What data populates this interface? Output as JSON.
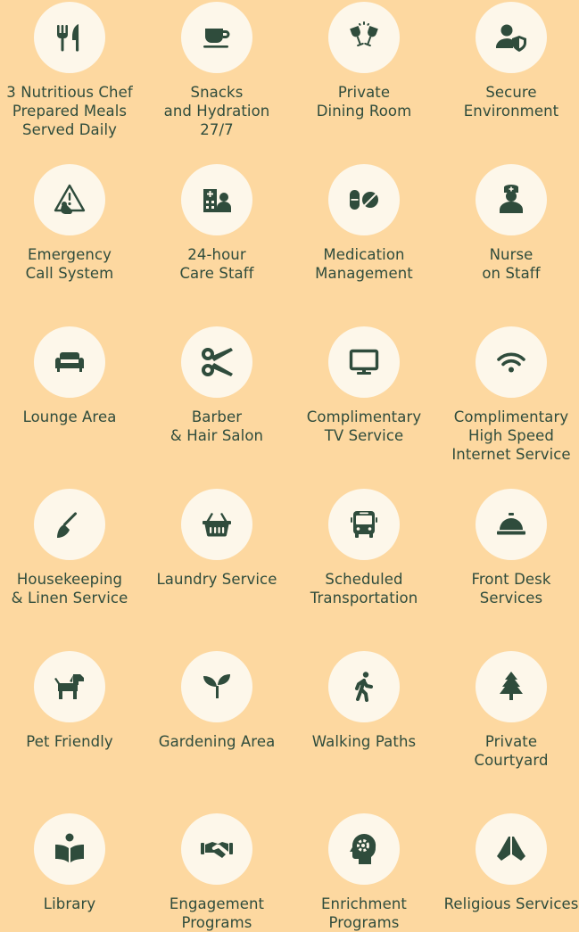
{
  "amenities": [
    {
      "label": "3 Nutritious Chef\nPrepared Meals\nServed Daily",
      "icon": "utensils-icon"
    },
    {
      "label": "Snacks\nand Hydration\n27/7",
      "icon": "coffee-cup-icon"
    },
    {
      "label": "Private\nDining Room",
      "icon": "wine-glasses-icon"
    },
    {
      "label": "Secure\nEnvironment",
      "icon": "user-shield-icon"
    },
    {
      "label": "Emergency\nCall System",
      "icon": "emergency-alert-icon"
    },
    {
      "label": "24-hour\nCare Staff",
      "icon": "hospital-user-icon"
    },
    {
      "label": "Medication\nManagement",
      "icon": "pills-icon"
    },
    {
      "label": "Nurse\non Staff",
      "icon": "nurse-icon"
    },
    {
      "label": "Lounge Area",
      "icon": "couch-icon"
    },
    {
      "label": "Barber\n& Hair Salon",
      "icon": "scissors-icon"
    },
    {
      "label": "Complimentary\nTV Service",
      "icon": "tv-icon"
    },
    {
      "label": "Complimentary\nHigh Speed\nInternet Service",
      "icon": "wifi-icon"
    },
    {
      "label": "Housekeeping\n& Linen Service",
      "icon": "broom-icon"
    },
    {
      "label": "Laundry Service",
      "icon": "laundry-basket-icon"
    },
    {
      "label": "Scheduled\nTransportation",
      "icon": "bus-icon"
    },
    {
      "label": "Front Desk\nServices",
      "icon": "concierge-bell-icon"
    },
    {
      "label": "Pet Friendly",
      "icon": "dog-icon"
    },
    {
      "label": "Gardening Area",
      "icon": "seedling-icon"
    },
    {
      "label": "Walking Paths",
      "icon": "walking-person-icon"
    },
    {
      "label": "Private\nCourtyard",
      "icon": "tree-icon"
    },
    {
      "label": "Library",
      "icon": "book-reader-icon"
    },
    {
      "label": "Engagement\nPrograms",
      "icon": "handshake-icon"
    },
    {
      "label": "Enrichment\nPrograms",
      "icon": "head-gear-icon"
    },
    {
      "label": "Religious Services",
      "icon": "praying-hands-icon"
    }
  ],
  "colors": {
    "background": "#fdd8a0",
    "circle": "#fdf7ea",
    "icon_and_text": "#2f4c3c"
  }
}
